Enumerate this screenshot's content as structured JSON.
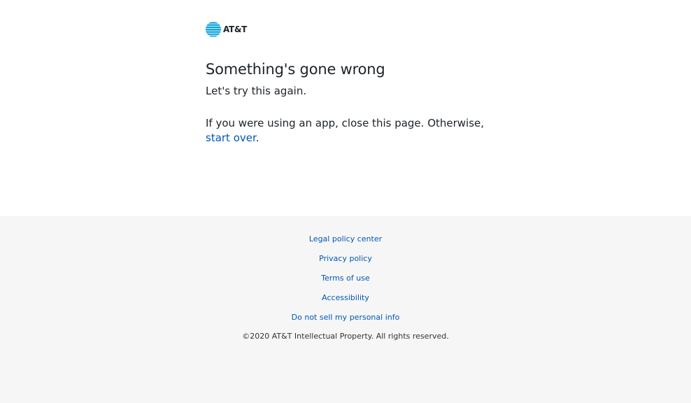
{
  "brand": {
    "logo_text": "AT&T",
    "logo_icon": "att-globe-icon",
    "logo_color": "#009fdb"
  },
  "error": {
    "title": "Something's gone wrong",
    "subtitle": "Let's try this again.",
    "message_prefix": "If you were using an app, close this page. Otherwise,",
    "link_label": "start over",
    "message_suffix": "."
  },
  "footer": {
    "links": [
      "Legal policy center",
      "Privacy policy",
      "Terms of use",
      "Accessibility",
      "Do not sell my personal info"
    ],
    "copyright": "©2020 AT&T Intellectual Property. All rights reserved."
  },
  "colors": {
    "link": "#0057b8",
    "text": "#1d2329",
    "footer_bg": "#f6f6f6"
  }
}
